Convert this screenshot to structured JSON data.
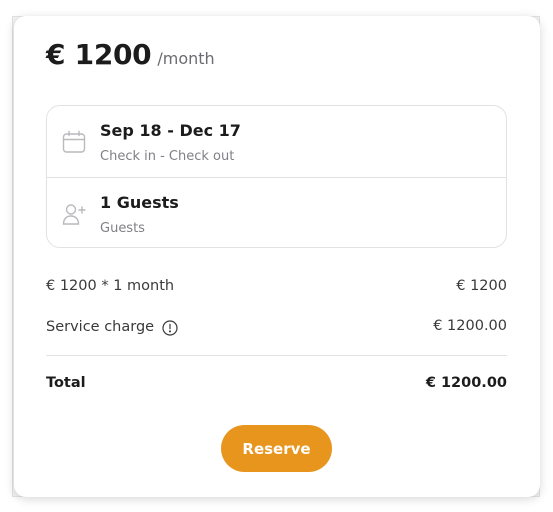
{
  "price": {
    "amount": "€ 1200",
    "unit": "/month"
  },
  "booking": {
    "dates": {
      "icon": "calendar-icon",
      "value": "Sep 18 - Dec 17",
      "label": "Check in - Check out"
    },
    "guests": {
      "icon": "add-user-icon",
      "value": "1 Guests",
      "label": "Guests"
    }
  },
  "summary": {
    "rent": {
      "label": "€ 1200 * 1 month",
      "amount": "€ 1200"
    },
    "service": {
      "label": "Service charge",
      "icon": "info-icon",
      "amount": "€ 1200.00"
    },
    "total": {
      "label": "Total",
      "amount": "€ 1200.00"
    }
  },
  "actions": {
    "reserve_label": "Reserve"
  },
  "colors": {
    "accent": "#e8951e",
    "text_primary": "#1c1c1c",
    "text_secondary": "#808086",
    "border": "#e2e2e2"
  }
}
